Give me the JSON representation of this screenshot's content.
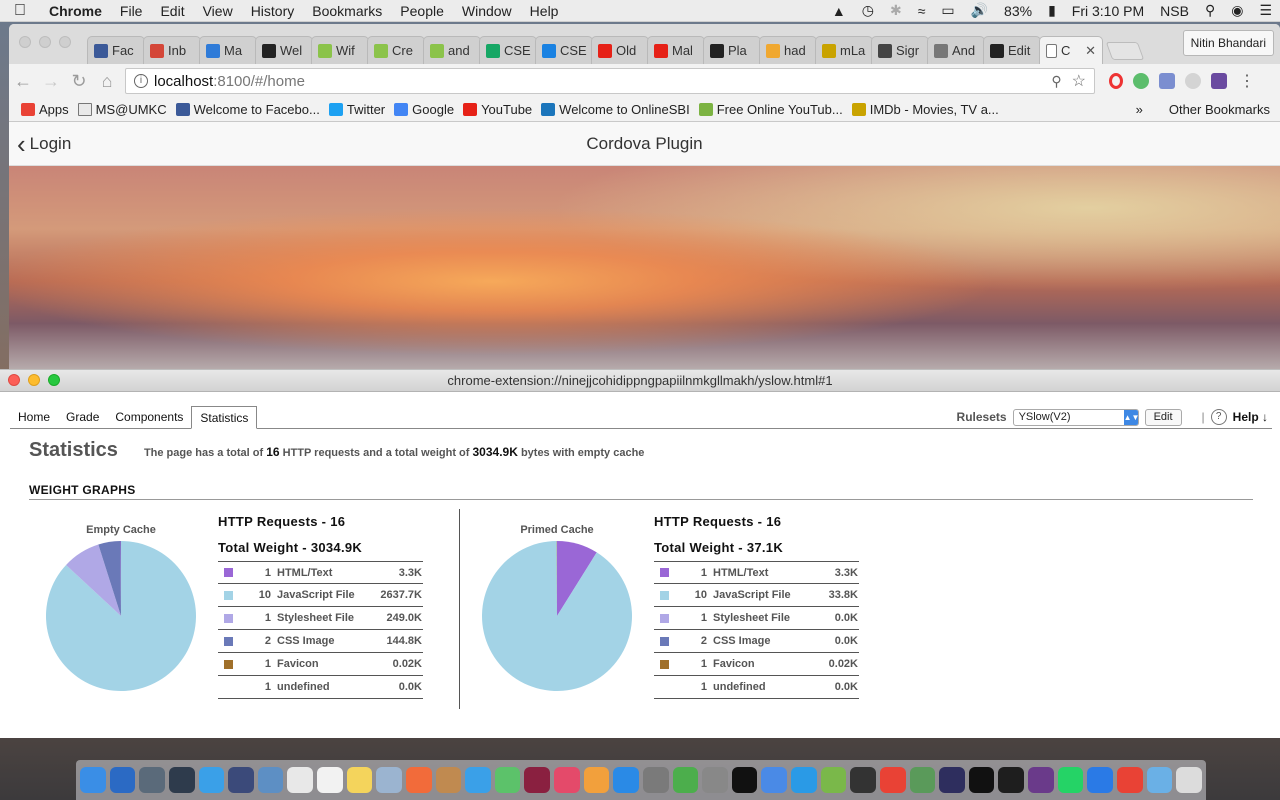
{
  "menubar": {
    "app_name": "Chrome",
    "items": [
      "File",
      "Edit",
      "View",
      "History",
      "Bookmarks",
      "People",
      "Window",
      "Help"
    ],
    "battery": "83%",
    "clock": "Fri 3:10 PM",
    "user": "NSB"
  },
  "browser": {
    "tabs": [
      {
        "label": "Fac",
        "color": "#3b5998"
      },
      {
        "label": "Inb",
        "color": "#d44638"
      },
      {
        "label": "Ma",
        "color": "#2f7bd8"
      },
      {
        "label": "Wel",
        "color": "#222222"
      },
      {
        "label": "Wif",
        "color": "#8bc34a"
      },
      {
        "label": "Cre",
        "color": "#8bc34a"
      },
      {
        "label": "and",
        "color": "#8bc34a"
      },
      {
        "label": "CSE",
        "color": "#16a765"
      },
      {
        "label": "CSE",
        "color": "#1a82e2"
      },
      {
        "label": "Old",
        "color": "#e62117"
      },
      {
        "label": "Mal",
        "color": "#e62117"
      },
      {
        "label": "Pla",
        "color": "#222222"
      },
      {
        "label": "had",
        "color": "#f0a830"
      },
      {
        "label": "mLa",
        "color": "#c9a300"
      },
      {
        "label": "Sigr",
        "color": "#444444"
      },
      {
        "label": "And",
        "color": "#777777"
      },
      {
        "label": "Edit",
        "color": "#222222"
      }
    ],
    "active_tab_label": "C",
    "profile_name": "Nitin Bhandari",
    "url_host": "localhost",
    "url_path": ":8100/#/home",
    "bookmarks": [
      {
        "label": "Apps",
        "color": "#e94235"
      },
      {
        "label": "MS@UMKC",
        "color": "folder"
      },
      {
        "label": "Welcome to Facebo...",
        "color": "#3b5998"
      },
      {
        "label": "Twitter",
        "color": "#1da1f2"
      },
      {
        "label": "Google",
        "color": "#4285f4"
      },
      {
        "label": "YouTube",
        "color": "#e62117"
      },
      {
        "label": "Welcome to OnlineSBI",
        "color": "#1b75bb"
      },
      {
        "label": "Free Online YouTub...",
        "color": "#7cb342"
      },
      {
        "label": "IMDb - Movies, TV a...",
        "color": "#c9a300"
      }
    ],
    "other_bookmarks": "Other Bookmarks",
    "overflow": "»"
  },
  "app": {
    "back_label": "Login",
    "title": "Cordova Plugin"
  },
  "yslow": {
    "window_title": "chrome-extension://ninejjcohidippngpapiilnmkgllmakh/yslow.html#1",
    "tabs": [
      "Home",
      "Grade",
      "Components",
      "Statistics"
    ],
    "active_tab": "Statistics",
    "rulesets_label": "Rulesets",
    "ruleset_value": "YSlow(V2)",
    "edit_label": "Edit",
    "help_label": "Help ↓",
    "help_icon": "?",
    "heading": "Statistics",
    "summary": {
      "prefix": "The page has a total of",
      "requests": "16",
      "mid": "HTTP requests and a total weight of",
      "weight": "3034.9K",
      "suffix": "bytes with empty cache"
    },
    "weight_graphs_label": "WEIGHT GRAPHS",
    "empty": {
      "pie_label": "Empty Cache",
      "requests_label": "HTTP Requests - 16",
      "weight_label": "Total Weight - 3034.9K",
      "rows": [
        {
          "count": "1",
          "name": "HTML/Text",
          "size": "3.3K",
          "color": "#9a67d6"
        },
        {
          "count": "10",
          "name": "JavaScript File",
          "size": "2637.7K",
          "color": "#a3d3e6"
        },
        {
          "count": "1",
          "name": "Stylesheet File",
          "size": "249.0K",
          "color": "#b0a8e6"
        },
        {
          "count": "2",
          "name": "CSS Image",
          "size": "144.8K",
          "color": "#6a79b8"
        },
        {
          "count": "1",
          "name": "Favicon",
          "size": "0.02K",
          "color": "#a0702a"
        },
        {
          "count": "1",
          "name": "undefined",
          "size": "0.0K",
          "color": ""
        }
      ],
      "slices_kb": [
        3.3,
        2637.7,
        249.0,
        144.8,
        0.02
      ]
    },
    "primed": {
      "pie_label": "Primed Cache",
      "requests_label": "HTTP Requests - 16",
      "weight_label": "Total Weight - 37.1K",
      "rows": [
        {
          "count": "1",
          "name": "HTML/Text",
          "size": "3.3K",
          "color": "#9a67d6"
        },
        {
          "count": "10",
          "name": "JavaScript File",
          "size": "33.8K",
          "color": "#a3d3e6"
        },
        {
          "count": "1",
          "name": "Stylesheet File",
          "size": "0.0K",
          "color": "#b0a8e6"
        },
        {
          "count": "2",
          "name": "CSS Image",
          "size": "0.0K",
          "color": "#6a79b8"
        },
        {
          "count": "1",
          "name": "Favicon",
          "size": "0.02K",
          "color": "#a0702a"
        },
        {
          "count": "1",
          "name": "undefined",
          "size": "0.0K",
          "color": ""
        }
      ],
      "slices_kb": [
        3.3,
        33.8,
        0,
        0,
        0.02
      ]
    }
  },
  "dock_colors": [
    "#3a8ee6",
    "#2b6ac4",
    "#5a6a7a",
    "#2e3b4c",
    "#3aa0e8",
    "#3b4a7a",
    "#5d8fc4",
    "#e8e8e8",
    "#f2f2f2",
    "#f4d45c",
    "#9bb4d0",
    "#f26b3a",
    "#c08a50",
    "#3aa0e8",
    "#5cc26a",
    "#8a2040",
    "#e44a6a",
    "#f2a03c",
    "#2a8ae6",
    "#7a7a7a",
    "#4cae4c",
    "#888888",
    "#111111",
    "#4a8ae6",
    "#2a9ae6",
    "#7ab84a",
    "#333333",
    "#e94235",
    "#5a9a5a",
    "#2e2e5e",
    "#111111",
    "#1e1e1e",
    "#6a3a8a",
    "#25d366",
    "#2a7ae6",
    "#e94235",
    "#6ab0e6",
    "#dcdcdc"
  ]
}
